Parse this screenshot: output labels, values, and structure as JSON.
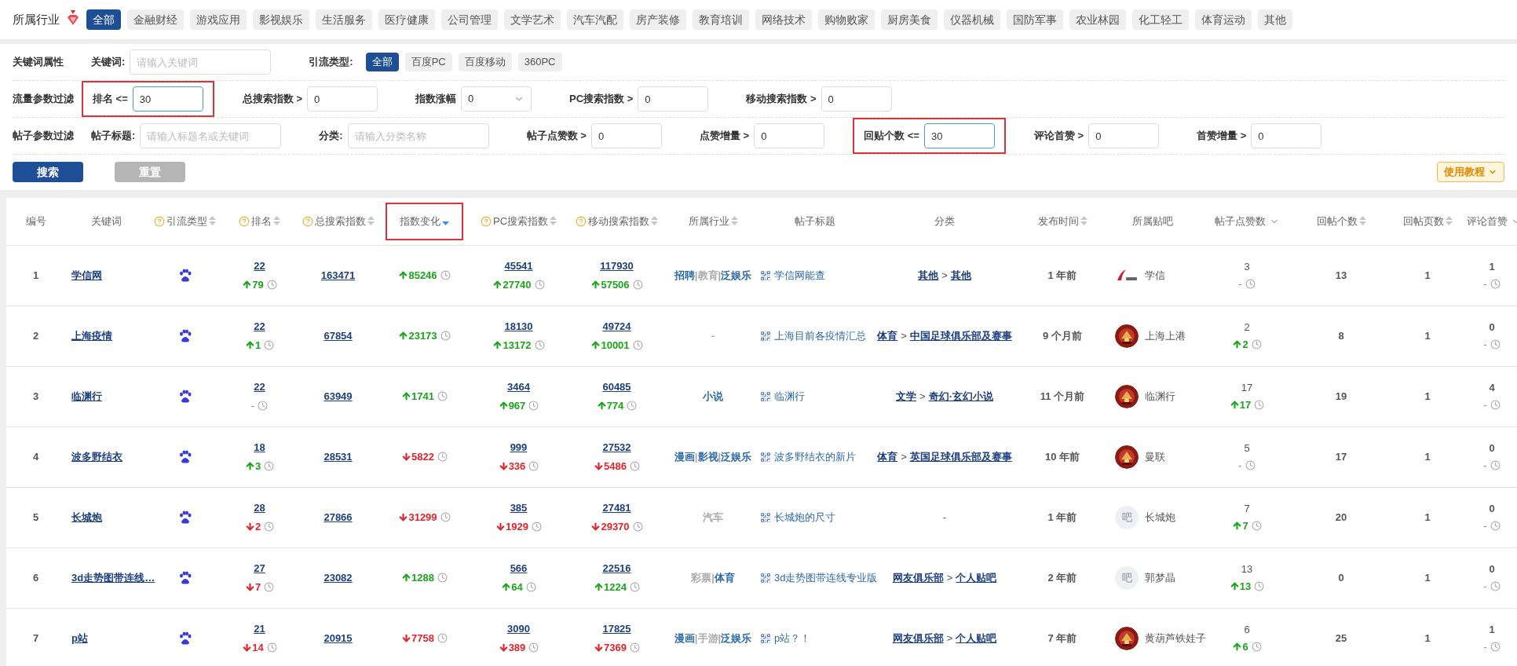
{
  "industry": {
    "label": "所属行业",
    "tags": [
      {
        "label": "全部",
        "selected": true
      },
      {
        "label": "金融财经",
        "selected": false
      },
      {
        "label": "游戏应用",
        "selected": false
      },
      {
        "label": "影视娱乐",
        "selected": false
      },
      {
        "label": "生活服务",
        "selected": false
      },
      {
        "label": "医疗健康",
        "selected": false
      },
      {
        "label": "公司管理",
        "selected": false
      },
      {
        "label": "文学艺术",
        "selected": false
      },
      {
        "label": "汽车汽配",
        "selected": false
      },
      {
        "label": "房产装修",
        "selected": false
      },
      {
        "label": "教育培训",
        "selected": false
      },
      {
        "label": "网络技术",
        "selected": false
      },
      {
        "label": "购物败家",
        "selected": false
      },
      {
        "label": "厨房美食",
        "selected": false
      },
      {
        "label": "仪器机械",
        "selected": false
      },
      {
        "label": "国防军事",
        "selected": false
      },
      {
        "label": "农业林园",
        "selected": false
      },
      {
        "label": "化工轻工",
        "selected": false
      },
      {
        "label": "体育运动",
        "selected": false
      },
      {
        "label": "其他",
        "selected": false
      }
    ]
  },
  "filters": [
    {
      "label": "关键词属性",
      "items": [
        {
          "kind": "text",
          "label": "关键词:",
          "placeholder": "请输入关键词",
          "highlighted": false
        },
        {
          "kind": "options",
          "label": "引流类型:",
          "options": [
            {
              "label": "全部",
              "selected": true
            },
            {
              "label": "百度PC",
              "selected": false
            },
            {
              "label": "百度移动",
              "selected": false
            },
            {
              "label": "360PC",
              "selected": false
            }
          ]
        }
      ]
    },
    {
      "label": "流量参数过滤",
      "items": [
        {
          "kind": "text",
          "label": "排名 <=",
          "value": "30",
          "highlighted": true
        },
        {
          "kind": "text",
          "label": "总搜索指数 >",
          "value": "0",
          "highlighted": false
        },
        {
          "kind": "select",
          "label": "指数涨幅",
          "value": "0"
        },
        {
          "kind": "text",
          "label": "PC搜索指数 >",
          "value": "0",
          "highlighted": false
        },
        {
          "kind": "text",
          "label": "移动搜索指数 >",
          "value": "0",
          "highlighted": false
        }
      ]
    },
    {
      "label": "帖子参数过滤",
      "items": [
        {
          "kind": "text",
          "label": "帖子标题:",
          "placeholder": "请输入标题名或关键词",
          "highlighted": false
        },
        {
          "kind": "text",
          "label": "分类:",
          "placeholder": "请输入分类名称",
          "highlighted": false
        },
        {
          "kind": "text",
          "label": "帖子点赞数 >",
          "value": "0",
          "highlighted": false
        },
        {
          "kind": "text",
          "label": "点赞增量 >",
          "value": "0",
          "highlighted": false
        },
        {
          "kind": "text",
          "label": "回贴个数 <=",
          "value": "30",
          "highlighted": true
        },
        {
          "kind": "text",
          "label": "评论首赞 >",
          "value": "0",
          "highlighted": false
        },
        {
          "kind": "text",
          "label": "首赞增量 >",
          "value": "0",
          "highlighted": false
        }
      ]
    }
  ],
  "buttons": {
    "search": "搜索",
    "reset": "重置",
    "tutorial": "使用教程"
  },
  "table": {
    "columns": [
      {
        "label": "编号",
        "help": false,
        "kind": "plain",
        "highlighted": false
      },
      {
        "label": "关键词",
        "help": false,
        "kind": "plain",
        "highlighted": false
      },
      {
        "label": "引流类型",
        "help": true,
        "kind": "updown",
        "highlighted": false
      },
      {
        "label": "排名",
        "help": true,
        "kind": "updown",
        "highlighted": false
      },
      {
        "label": "总搜索指数",
        "help": true,
        "kind": "updown",
        "highlighted": false
      },
      {
        "label": "指数变化",
        "help": false,
        "kind": "desc",
        "highlighted": true
      },
      {
        "label": "PC搜索指数",
        "help": true,
        "kind": "updown",
        "highlighted": false
      },
      {
        "label": "移动搜索指数",
        "help": true,
        "kind": "updown",
        "highlighted": false
      },
      {
        "label": "所属行业",
        "help": false,
        "kind": "updown",
        "highlighted": false
      },
      {
        "label": "帖子标题",
        "help": false,
        "kind": "plain",
        "highlighted": false
      },
      {
        "label": "分类",
        "help": false,
        "kind": "plain",
        "highlighted": false
      },
      {
        "label": "发布时间",
        "help": false,
        "kind": "updown",
        "highlighted": false
      },
      {
        "label": "所属贴吧",
        "help": false,
        "kind": "plain",
        "highlighted": false
      },
      {
        "label": "帖子点赞数",
        "help": false,
        "kind": "chevron",
        "highlighted": false
      },
      {
        "label": "回帖个数",
        "help": false,
        "kind": "updown",
        "highlighted": false
      },
      {
        "label": "回帖页数",
        "help": false,
        "kind": "updown",
        "highlighted": false
      },
      {
        "label": "评论首赞",
        "help": false,
        "kind": "chevron",
        "highlighted": false
      }
    ],
    "rows": [
      {
        "no": "1",
        "keyword": "学信网",
        "rank": {
          "value": "22",
          "change": {
            "kind": "up",
            "value": "79"
          }
        },
        "total": "163471",
        "index_change": {
          "kind": "up",
          "value": "85246"
        },
        "pc": {
          "value": "45541",
          "change": {
            "kind": "up",
            "value": "27740"
          }
        },
        "mobile": {
          "value": "117930",
          "change": {
            "kind": "up",
            "value": "57506"
          }
        },
        "industry": [
          {
            "text": "招聘",
            "linked": true
          },
          {
            "text": "|",
            "linked": false
          },
          {
            "text": "教育",
            "linked": false
          },
          {
            "text": "|",
            "linked": false
          },
          {
            "text": "泛娱乐",
            "linked": true
          }
        ],
        "title": "学信网能查",
        "category": [
          {
            "text": "其他",
            "linked": true
          },
          {
            "text": ">",
            "linked": false
          },
          {
            "text": "其他",
            "linked": true
          }
        ],
        "time": "1 年前",
        "forum": {
          "name": "学信",
          "avatar": {
            "kind": "logo"
          }
        },
        "likes": {
          "value": "3",
          "change": {
            "kind": "none",
            "value": "-"
          }
        },
        "replies": "13",
        "pages": "1",
        "comment_likes": {
          "value": "1",
          "change": {
            "kind": "none",
            "value": "-"
          }
        }
      },
      {
        "no": "2",
        "keyword": "上海疫情",
        "rank": {
          "value": "22",
          "change": {
            "kind": "up",
            "value": "1"
          }
        },
        "total": "67854",
        "index_change": {
          "kind": "up",
          "value": "23173"
        },
        "pc": {
          "value": "18130",
          "change": {
            "kind": "up",
            "value": "13172"
          }
        },
        "mobile": {
          "value": "49724",
          "change": {
            "kind": "up",
            "value": "10001"
          }
        },
        "industry": [
          {
            "text": "-",
            "linked": false
          }
        ],
        "title": "上海目前各疫情汇总",
        "category": [
          {
            "text": "体育",
            "linked": true
          },
          {
            "text": ">",
            "linked": false
          },
          {
            "text": "中国足球俱乐部及赛事",
            "linked": true
          }
        ],
        "time": "9 个月前",
        "forum": {
          "name": "上海上港"
        },
        "likes": {
          "value": "2",
          "change": {
            "kind": "up",
            "value": "2"
          }
        },
        "replies": "8",
        "pages": "1",
        "comment_likes": {
          "value": "0",
          "change": {
            "kind": "none",
            "value": "-"
          }
        }
      },
      {
        "no": "3",
        "keyword": "临渊行",
        "rank": {
          "value": "22",
          "change": {
            "kind": "none",
            "value": "-"
          }
        },
        "total": "63949",
        "index_change": {
          "kind": "up",
          "value": "1741"
        },
        "pc": {
          "value": "3464",
          "change": {
            "kind": "up",
            "value": "967"
          }
        },
        "mobile": {
          "value": "60485",
          "change": {
            "kind": "up",
            "value": "774"
          }
        },
        "industry": [
          {
            "text": "小说",
            "linked": true
          }
        ],
        "title": "临渊行",
        "category": [
          {
            "text": "文学",
            "linked": true
          },
          {
            "text": ">",
            "linked": false
          },
          {
            "text": "奇幻·玄幻小说",
            "linked": true
          }
        ],
        "time": "11 个月前",
        "forum": {
          "name": "临渊行"
        },
        "likes": {
          "value": "17",
          "change": {
            "kind": "up",
            "value": "17"
          }
        },
        "replies": "19",
        "pages": "1",
        "comment_likes": {
          "value": "4",
          "change": {
            "kind": "none",
            "value": "-"
          }
        }
      },
      {
        "no": "4",
        "keyword": "波多野结衣",
        "rank": {
          "value": "18",
          "change": {
            "kind": "up",
            "value": "3"
          }
        },
        "total": "28531",
        "index_change": {
          "kind": "down",
          "value": "5822"
        },
        "pc": {
          "value": "999",
          "change": {
            "kind": "down",
            "value": "336"
          }
        },
        "mobile": {
          "value": "27532",
          "change": {
            "kind": "down",
            "value": "5486"
          }
        },
        "industry": [
          {
            "text": "漫画",
            "linked": true
          },
          {
            "text": "|",
            "linked": false
          },
          {
            "text": "影视",
            "linked": true
          },
          {
            "text": "|",
            "linked": false
          },
          {
            "text": "泛娱乐",
            "linked": true
          }
        ],
        "title": "波多野结衣的新片",
        "category": [
          {
            "text": "体育",
            "linked": true
          },
          {
            "text": ">",
            "linked": false
          },
          {
            "text": "英国足球俱乐部及赛事",
            "linked": true
          }
        ],
        "time": "10 年前",
        "forum": {
          "name": "曼联"
        },
        "likes": {
          "value": "5",
          "change": {
            "kind": "none",
            "value": "-"
          }
        },
        "replies": "17",
        "pages": "1",
        "comment_likes": {
          "value": "0",
          "change": {
            "kind": "none",
            "value": "-"
          }
        }
      },
      {
        "no": "5",
        "keyword": "长城炮",
        "rank": {
          "value": "28",
          "change": {
            "kind": "down",
            "value": "2"
          }
        },
        "total": "27866",
        "index_change": {
          "kind": "down",
          "value": "31299"
        },
        "pc": {
          "value": "385",
          "change": {
            "kind": "down",
            "value": "1929"
          }
        },
        "mobile": {
          "value": "27481",
          "change": {
            "kind": "down",
            "value": "29370"
          }
        },
        "industry": [
          {
            "text": "汽车",
            "linked": false
          }
        ],
        "title": "长城炮的尺寸",
        "category": [
          {
            "text": "-",
            "linked": false
          }
        ],
        "time": "1 年前",
        "forum": {
          "name": "长城炮",
          "avatar": {
            "kind": "default",
            "text": "吧"
          }
        },
        "likes": {
          "value": "7",
          "change": {
            "kind": "up",
            "value": "7"
          }
        },
        "replies": "20",
        "pages": "1",
        "comment_likes": {
          "value": "0",
          "change": {
            "kind": "none",
            "value": "-"
          }
        }
      },
      {
        "no": "6",
        "keyword": "3d走势图带连线…",
        "rank": {
          "value": "27",
          "change": {
            "kind": "down",
            "value": "7"
          }
        },
        "total": "23082",
        "index_change": {
          "kind": "up",
          "value": "1288"
        },
        "pc": {
          "value": "566",
          "change": {
            "kind": "up",
            "value": "64"
          }
        },
        "mobile": {
          "value": "22516",
          "change": {
            "kind": "up",
            "value": "1224"
          }
        },
        "industry": [
          {
            "text": "彩票",
            "linked": false
          },
          {
            "text": "|",
            "linked": false
          },
          {
            "text": "体育",
            "linked": true
          }
        ],
        "title": "3d走势图带连线专业版",
        "category": [
          {
            "text": "网友俱乐部",
            "linked": true
          },
          {
            "text": ">",
            "linked": false
          },
          {
            "text": "个人贴吧",
            "linked": true
          }
        ],
        "time": "2 年前",
        "forum": {
          "name": "郭梦晶",
          "avatar": {
            "kind": "default",
            "text": "吧"
          }
        },
        "likes": {
          "value": "13",
          "change": {
            "kind": "up",
            "value": "13"
          }
        },
        "replies": "0",
        "pages": "1",
        "comment_likes": {
          "value": "0",
          "change": {
            "kind": "none",
            "value": "-"
          }
        }
      },
      {
        "no": "7",
        "keyword": "p站",
        "rank": {
          "value": "21",
          "change": {
            "kind": "down",
            "value": "14"
          }
        },
        "total": "20915",
        "index_change": {
          "kind": "down",
          "value": "7758"
        },
        "pc": {
          "value": "3090",
          "change": {
            "kind": "down",
            "value": "389"
          }
        },
        "mobile": {
          "value": "17825",
          "change": {
            "kind": "down",
            "value": "7369"
          }
        },
        "industry": [
          {
            "text": "漫画",
            "linked": true
          },
          {
            "text": "|",
            "linked": false
          },
          {
            "text": "手游",
            "linked": false
          },
          {
            "text": "|",
            "linked": false
          },
          {
            "text": "泛娱乐",
            "linked": true
          }
        ],
        "title": "p站？！",
        "category": [
          {
            "text": "网友俱乐部",
            "linked": true
          },
          {
            "text": ">",
            "linked": false
          },
          {
            "text": "个人贴吧",
            "linked": true
          }
        ],
        "time": "7 年前",
        "forum": {
          "name": "黄葫芦铁娃子"
        },
        "likes": {
          "value": "6",
          "change": {
            "kind": "up",
            "value": "6"
          }
        },
        "replies": "25",
        "pages": "1",
        "comment_likes": {
          "value": "1",
          "change": {
            "kind": "none",
            "value": "-"
          }
        }
      }
    ]
  }
}
